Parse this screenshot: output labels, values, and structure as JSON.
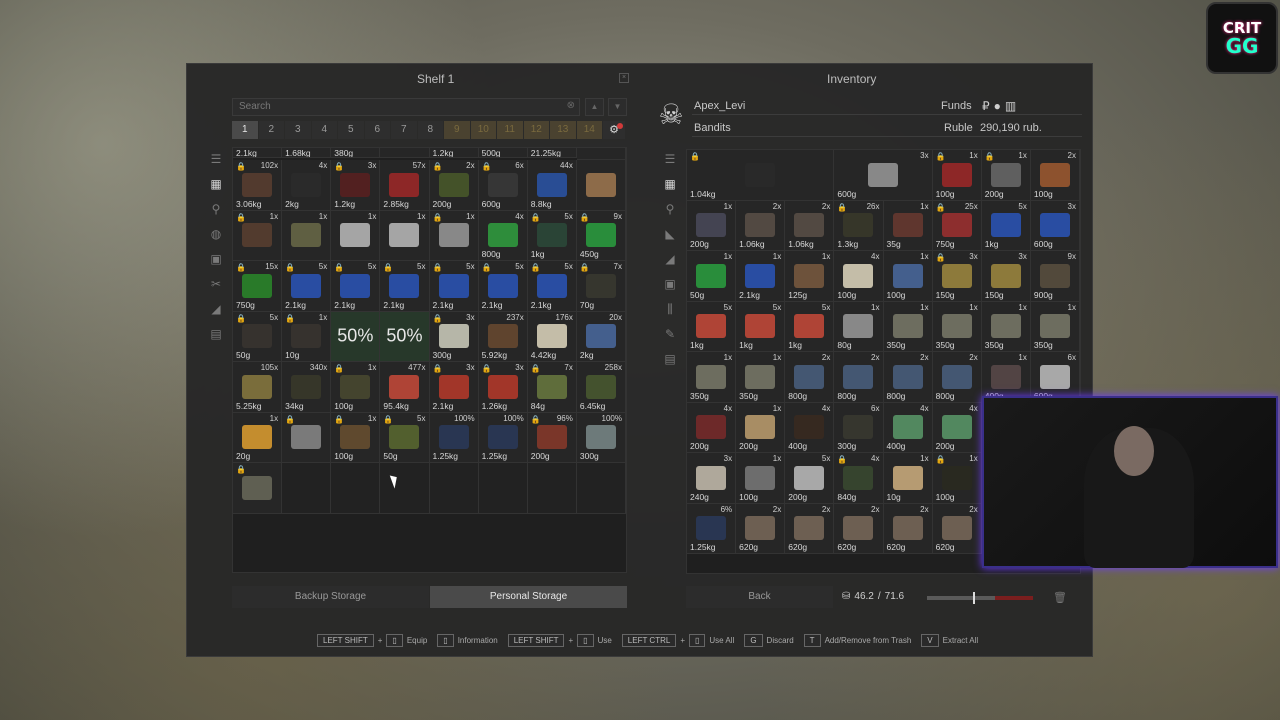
{
  "shelf": {
    "title": "Shelf 1",
    "search_placeholder": "Search",
    "tabs": [
      "1",
      "2",
      "3",
      "4",
      "5",
      "6",
      "7",
      "8",
      "9",
      "10",
      "11",
      "12",
      "13",
      "14"
    ],
    "top_row_weights": [
      "2.1kg",
      "1.68kg",
      "380g",
      "",
      "1.2kg",
      "500g",
      "21.25kg"
    ],
    "rows": [
      [
        {
          "c": "102x",
          "w": "3.06kg",
          "lock": true,
          "color": "#5a3e30"
        },
        {
          "c": "4x",
          "w": "2kg",
          "color": "#2c2c2c"
        },
        {
          "c": "3x",
          "w": "1.2kg",
          "lock": true,
          "color": "#5b2020"
        },
        {
          "c": "57x",
          "w": "2.85kg",
          "color": "#a02828"
        },
        {
          "c": "2x",
          "w": "200g",
          "lock": true,
          "color": "#4a5a2a"
        },
        {
          "c": "6x",
          "w": "600g",
          "lock": true,
          "color": "#3a3a3a"
        },
        {
          "c": "44x",
          "w": "8.8kg",
          "color": "#2a55a8"
        },
        {
          "c": "",
          "w": "",
          "color": "#a07850"
        }
      ],
      [
        {
          "c": "1x",
          "w": "",
          "lock": true,
          "color": "#5a4030"
        },
        {
          "c": "1x",
          "w": "",
          "color": "#6a6a48"
        },
        {
          "c": "1x",
          "w": "",
          "color": "#bcbcbc"
        },
        {
          "c": "1x",
          "w": "",
          "color": "#bcbcbc"
        },
        {
          "c": "1x",
          "w": "",
          "lock": true,
          "color": "#9a9a9a"
        },
        {
          "c": "4x",
          "w": "800g",
          "color": "#30a040"
        },
        {
          "c": "5x",
          "w": "1kg",
          "lock": true,
          "color": "#2c4a3a"
        },
        {
          "c": "9x",
          "w": "450g",
          "lock": true,
          "color": "#2aa040"
        }
      ],
      [
        {
          "c": "15x",
          "w": "750g",
          "lock": true,
          "color": "#2a8a2a"
        },
        {
          "c": "5x",
          "w": "2.1kg",
          "lock": true,
          "color": "#2a55b8"
        },
        {
          "c": "5x",
          "w": "2.1kg",
          "lock": true,
          "color": "#2a55b8"
        },
        {
          "c": "5x",
          "w": "2.1kg",
          "lock": true,
          "color": "#2a55b8"
        },
        {
          "c": "5x",
          "w": "2.1kg",
          "lock": true,
          "color": "#2a55b8"
        },
        {
          "c": "5x",
          "w": "2.1kg",
          "lock": true,
          "color": "#2a55b8"
        },
        {
          "c": "5x",
          "w": "2.1kg",
          "lock": true,
          "color": "#2a55b8"
        },
        {
          "c": "7x",
          "w": "70g",
          "lock": true,
          "color": "#3a3a30"
        }
      ],
      [
        {
          "c": "5x",
          "w": "50g",
          "lock": true,
          "color": "#3a3530"
        },
        {
          "c": "1x",
          "w": "10g",
          "lock": true,
          "color": "#3a3530"
        },
        {
          "c": "",
          "w": "",
          "pct": "50%",
          "green": true,
          "color": ""
        },
        {
          "c": "",
          "w": "",
          "pct": "50%",
          "green": true,
          "color": ""
        },
        {
          "c": "3x",
          "w": "300g",
          "lock": true,
          "color": "#d0d0c0"
        },
        {
          "c": "237x",
          "w": "5.92kg",
          "color": "#6a4a30"
        },
        {
          "c": "176x",
          "w": "4.42kg",
          "color": "#e0d8c0"
        },
        {
          "c": "20x",
          "w": "2kg",
          "color": "#4a6aa0"
        }
      ],
      [
        {
          "c": "105x",
          "w": "5.25kg",
          "color": "#8a7a40"
        },
        {
          "c": "340x",
          "w": "34kg",
          "color": "#3a3a2a"
        },
        {
          "c": "1x",
          "w": "100g",
          "lock": true,
          "color": "#4a4a30"
        },
        {
          "c": "477x",
          "w": "95.4kg",
          "color": "#c84a3a"
        },
        {
          "c": "3x",
          "w": "2.1kg",
          "lock": true,
          "color": "#b83a2a"
        },
        {
          "c": "3x",
          "w": "1.26kg",
          "lock": true,
          "color": "#b83a2a"
        },
        {
          "c": "7x",
          "w": "84g",
          "lock": true,
          "color": "#6a7a40"
        },
        {
          "c": "258x",
          "w": "6.45kg",
          "color": "#4a5a30"
        }
      ],
      [
        {
          "c": "1x",
          "w": "20g",
          "color": "#e0a030"
        },
        {
          "c": "",
          "w": "",
          "lock": true,
          "color": "#8a8a8a"
        },
        {
          "c": "1x",
          "w": "100g",
          "lock": true,
          "color": "#6a5030"
        },
        {
          "c": "5x",
          "w": "50g",
          "lock": true,
          "color": "#5a6a30"
        },
        {
          "c": "100%",
          "w": "1.25kg",
          "color": "#2a3a5a"
        },
        {
          "c": "100%",
          "w": "1.25kg",
          "color": "#2a3a5a"
        },
        {
          "c": "96%",
          "w": "200g",
          "lock": true,
          "color": "#8a3a2a"
        },
        {
          "c": "100%",
          "w": "300g",
          "color": "#7a8a8a"
        }
      ],
      [
        {
          "c": "",
          "w": "",
          "lock": true,
          "color": "#6a6a5a"
        },
        {
          "c": "",
          "w": "",
          "empty": true
        },
        {
          "c": "",
          "w": "",
          "empty": true
        },
        {
          "c": "",
          "w": "",
          "empty": true
        },
        {
          "c": "",
          "w": "",
          "empty": true
        },
        {
          "c": "",
          "w": "",
          "empty": true
        },
        {
          "c": "",
          "w": "",
          "empty": true
        },
        {
          "c": "",
          "w": "",
          "empty": true
        }
      ]
    ],
    "backup_label": "Backup Storage",
    "personal_label": "Personal Storage"
  },
  "inventory": {
    "title": "Inventory",
    "player_name": "Apex_Levi",
    "faction": "Bandits",
    "funds_label": "Funds",
    "currency_label": "Ruble",
    "currency_value": "290,190 rub.",
    "rows": [
      [
        {
          "c": "",
          "w": "1.04kg",
          "lock": true,
          "color": "#2a2a2a",
          "span": "big"
        },
        {
          "c": "3x",
          "w": "600g",
          "color": "#9a9a9a",
          "span": "wide"
        },
        {
          "c": "1x",
          "w": "100g",
          "lock": true,
          "color": "#a02828"
        },
        {
          "c": "1x",
          "w": "200g",
          "lock": true,
          "color": "#6a6a6a"
        },
        {
          "c": "2x",
          "w": "100g",
          "color": "#a05a30"
        }
      ],
      [
        {
          "c": "1x",
          "w": "200g",
          "color": "#4a4a5a"
        },
        {
          "c": "2x",
          "w": "1.06kg",
          "color": "#5a5048"
        },
        {
          "c": "2x",
          "w": "1.06kg",
          "color": "#5a5048"
        },
        {
          "c": "26x",
          "w": "1.3kg",
          "lock": true,
          "color": "#3a3a2a"
        },
        {
          "c": "1x",
          "w": "35g",
          "color": "#6a3a30"
        },
        {
          "c": "25x",
          "w": "750g",
          "lock": true,
          "color": "#a03030"
        },
        {
          "c": "5x",
          "w": "1kg",
          "color": "#2a55b8"
        },
        {
          "c": "3x",
          "w": "600g",
          "color": "#2a55b8"
        }
      ],
      [
        {
          "c": "1x",
          "w": "50g",
          "color": "#2aa040"
        },
        {
          "c": "1x",
          "w": "2.1kg",
          "color": "#2a55b8"
        },
        {
          "c": "1x",
          "w": "125g",
          "color": "#7a5a40"
        },
        {
          "c": "4x",
          "w": "100g",
          "color": "#e0d8c0"
        },
        {
          "c": "1x",
          "w": "100g",
          "color": "#4a6aa0"
        },
        {
          "c": "3x",
          "w": "150g",
          "lock": true,
          "color": "#a08a40"
        },
        {
          "c": "3x",
          "w": "150g",
          "color": "#a08a40"
        },
        {
          "c": "9x",
          "w": "900g",
          "color": "#5a5040"
        }
      ],
      [
        {
          "c": "5x",
          "w": "1kg",
          "color": "#c84a3a"
        },
        {
          "c": "5x",
          "w": "1kg",
          "color": "#c84a3a"
        },
        {
          "c": "5x",
          "w": "1kg",
          "color": "#c84a3a"
        },
        {
          "c": "1x",
          "w": "80g",
          "color": "#9a9a9a"
        },
        {
          "c": "1x",
          "w": "350g",
          "color": "#7a7a6a"
        },
        {
          "c": "1x",
          "w": "350g",
          "color": "#7a7a6a"
        },
        {
          "c": "1x",
          "w": "350g",
          "color": "#7a7a6a"
        },
        {
          "c": "1x",
          "w": "350g",
          "color": "#7a7a6a"
        }
      ],
      [
        {
          "c": "1x",
          "w": "350g",
          "color": "#7a7a6a"
        },
        {
          "c": "1x",
          "w": "350g",
          "color": "#7a7a6a"
        },
        {
          "c": "2x",
          "w": "800g",
          "color": "#4a6080"
        },
        {
          "c": "2x",
          "w": "800g",
          "color": "#4a6080"
        },
        {
          "c": "2x",
          "w": "800g",
          "color": "#4a6080"
        },
        {
          "c": "2x",
          "w": "800g",
          "color": "#4a6080"
        },
        {
          "c": "1x",
          "w": "400g",
          "color": "#5a4a4a"
        },
        {
          "c": "6x",
          "w": "600g",
          "color": "#c0c0c0"
        }
      ],
      [
        {
          "c": "4x",
          "w": "200g",
          "color": "#7a2a2a"
        },
        {
          "c": "1x",
          "w": "200g",
          "color": "#c0a070"
        },
        {
          "c": "4x",
          "w": "400g",
          "color": "#3a2a20"
        },
        {
          "c": "6x",
          "w": "300g",
          "color": "#3a3a30"
        },
        {
          "c": "4x",
          "w": "400g",
          "color": "#5a9a6a"
        },
        {
          "c": "4x",
          "w": "200g",
          "color": "#5a9a6a"
        },
        {
          "c": "",
          "w": "",
          "empty": true
        },
        {
          "c": "",
          "w": "",
          "empty": true
        }
      ],
      [
        {
          "c": "3x",
          "w": "240g",
          "color": "#c8c0b0"
        },
        {
          "c": "1x",
          "w": "100g",
          "color": "#7a7a7a"
        },
        {
          "c": "5x",
          "w": "200g",
          "color": "#c0c0c0"
        },
        {
          "c": "4x",
          "w": "840g",
          "lock": true,
          "color": "#3a4a30"
        },
        {
          "c": "1x",
          "w": "10g",
          "color": "#d0b080"
        },
        {
          "c": "1x",
          "w": "100g",
          "lock": true,
          "color": "#2a2a20"
        },
        {
          "c": "",
          "w": "",
          "empty": true
        },
        {
          "c": "",
          "w": "",
          "empty": true
        }
      ],
      [
        {
          "c": "6%",
          "w": "1.25kg",
          "color": "#2a3a5a"
        },
        {
          "c": "2x",
          "w": "620g",
          "color": "#7a6a5a"
        },
        {
          "c": "2x",
          "w": "620g",
          "color": "#7a6a5a"
        },
        {
          "c": "2x",
          "w": "620g",
          "color": "#7a6a5a"
        },
        {
          "c": "2x",
          "w": "620g",
          "color": "#7a6a5a"
        },
        {
          "c": "2x",
          "w": "620g",
          "color": "#7a6a5a"
        },
        {
          "c": "",
          "w": "",
          "empty": true
        },
        {
          "c": "",
          "w": "",
          "empty": true
        }
      ]
    ],
    "back_label": "Back",
    "weight_current": "46.2",
    "weight_sep": "/",
    "weight_max": "71.6",
    "weight_fraction": 0.645
  },
  "hotkeys": [
    {
      "keys": [
        "LEFT SHIFT",
        "+"
      ],
      "label": "Equip"
    },
    {
      "keys": [],
      "label": "Information"
    },
    {
      "keys": [
        "LEFT SHIFT",
        "+"
      ],
      "label": "Use"
    },
    {
      "keys": [
        "LEFT CTRL",
        "+"
      ],
      "label": "Use All"
    },
    {
      "keys": [
        "G"
      ],
      "label": "Discard"
    },
    {
      "keys": [
        "T"
      ],
      "label": "Add/Remove from Trash"
    },
    {
      "keys": [
        "V"
      ],
      "label": "Extract All"
    }
  ],
  "overlay": {
    "logo_line1": "CRIT",
    "logo_line2": "GG"
  }
}
